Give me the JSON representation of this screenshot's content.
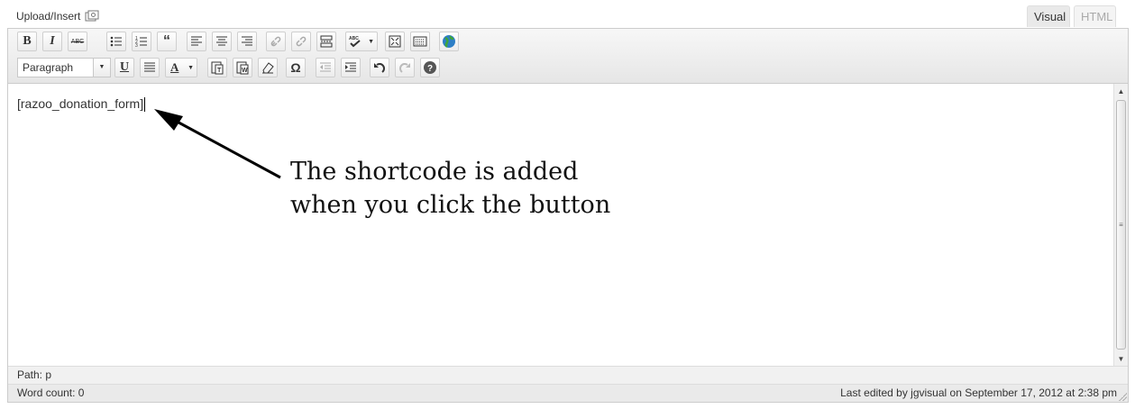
{
  "header": {
    "upload_label": "Upload/Insert",
    "tabs": {
      "visual": "Visual",
      "html": "HTML"
    }
  },
  "toolbar": {
    "row1": [
      {
        "name": "bold-button",
        "label": "B"
      },
      {
        "name": "italic-button",
        "label": "I"
      },
      {
        "name": "strikethrough-button",
        "label": "ABC"
      },
      {
        "name": "bullet-list-button",
        "icon": "bullet-list-icon"
      },
      {
        "name": "numbered-list-button",
        "icon": "numbered-list-icon"
      },
      {
        "name": "blockquote-button",
        "label": "“"
      },
      {
        "name": "align-left-button",
        "icon": "align-left-icon"
      },
      {
        "name": "align-center-button",
        "icon": "align-center-icon"
      },
      {
        "name": "align-right-button",
        "icon": "align-right-icon"
      },
      {
        "name": "insert-link-button",
        "icon": "link-icon"
      },
      {
        "name": "remove-link-button",
        "icon": "unlink-icon"
      },
      {
        "name": "insert-more-button",
        "icon": "more-tag-icon"
      },
      {
        "name": "spellcheck-button",
        "label": "ABC"
      },
      {
        "name": "fullscreen-button",
        "icon": "fullscreen-icon"
      },
      {
        "name": "kitchen-sink-button",
        "icon": "keyboard-icon"
      },
      {
        "name": "razoo-button",
        "icon": "globe-icon"
      }
    ],
    "row2": [
      {
        "name": "underline-button",
        "label": "U"
      },
      {
        "name": "justify-button",
        "icon": "justify-icon"
      },
      {
        "name": "text-color-button",
        "label": "A"
      },
      {
        "name": "paste-text-button",
        "icon": "paste-text-icon"
      },
      {
        "name": "paste-word-button",
        "icon": "paste-word-icon"
      },
      {
        "name": "clear-formatting-button",
        "icon": "eraser-icon"
      },
      {
        "name": "special-char-button",
        "label": "Ω"
      },
      {
        "name": "outdent-button",
        "icon": "outdent-icon"
      },
      {
        "name": "indent-button",
        "icon": "indent-icon"
      },
      {
        "name": "undo-button",
        "icon": "undo-icon"
      },
      {
        "name": "redo-button",
        "icon": "redo-icon"
      },
      {
        "name": "help-button",
        "icon": "help-icon"
      }
    ],
    "format_select": "Paragraph"
  },
  "content": {
    "text": "[razoo_donation_form]",
    "annotation_line1": "The shortcode is added",
    "annotation_line2": "when you click the button"
  },
  "status": {
    "path_label": "Path:",
    "path_value": "p",
    "word_count": "Word count: 0",
    "last_edited": "Last edited by jgvisual on September 17, 2012 at 2:38 pm"
  }
}
